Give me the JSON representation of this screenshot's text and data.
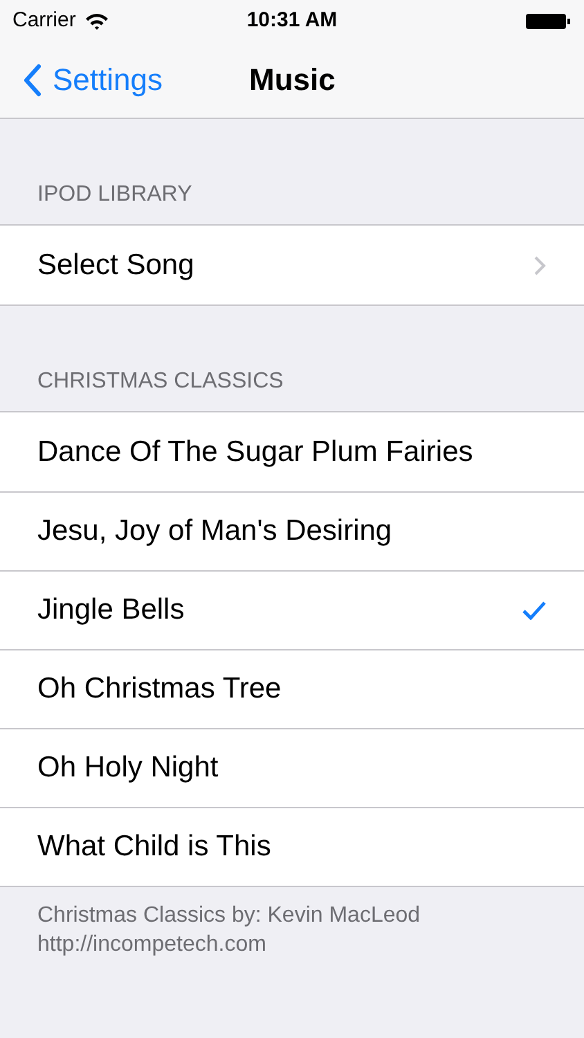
{
  "status_bar": {
    "carrier": "Carrier",
    "time": "10:31 AM"
  },
  "nav": {
    "back": "Settings",
    "title": "Music"
  },
  "sections": [
    {
      "header": "IPOD LIBRARY",
      "rows": [
        {
          "label": "Select Song",
          "kind": "disclosure"
        }
      ]
    },
    {
      "header": "CHRISTMAS CLASSICS",
      "rows": [
        {
          "label": "Dance Of The Sugar Plum Fairies",
          "kind": "choice",
          "selected": false
        },
        {
          "label": "Jesu, Joy of Man's Desiring",
          "kind": "choice",
          "selected": false
        },
        {
          "label": "Jingle Bells",
          "kind": "choice",
          "selected": true
        },
        {
          "label": "Oh Christmas Tree",
          "kind": "choice",
          "selected": false
        },
        {
          "label": "Oh Holy Night",
          "kind": "choice",
          "selected": false
        },
        {
          "label": "What Child is This",
          "kind": "choice",
          "selected": false
        }
      ],
      "footer": [
        "Christmas Classics by: Kevin MacLeod",
        "http://incompetech.com"
      ]
    }
  ]
}
